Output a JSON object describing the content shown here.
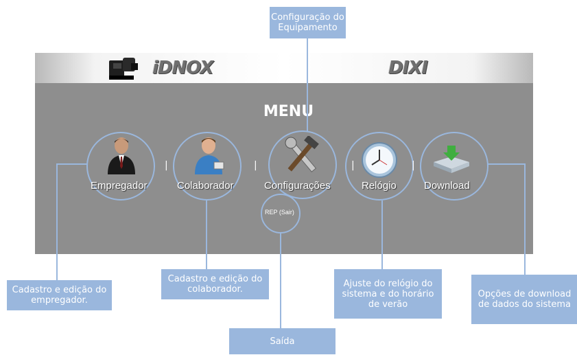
{
  "brand": {
    "left_logo": "iDNOX",
    "right_logo": "DIXI"
  },
  "menu": {
    "title": "MENU",
    "items": [
      {
        "label": "Empregador",
        "icon": "employer-icon"
      },
      {
        "label": "Colaborador",
        "icon": "collaborator-icon"
      },
      {
        "label": "Configurações",
        "icon": "tools-icon"
      },
      {
        "label": "Relógio",
        "icon": "clock-icon"
      },
      {
        "label": "Download",
        "icon": "download-icon"
      }
    ],
    "separator": "|",
    "exit_label": "REP (Sair)"
  },
  "callouts": {
    "config": "Configuração do Equipamento",
    "employer": "Cadastro e edição do empregador.",
    "collaborator": "Cadastro e edição do colaborador.",
    "clock": "Ajuste do relógio do sistema e do horário de verão",
    "download": "Opções de download de dados do sistema",
    "exit": "Saída"
  },
  "colors": {
    "panel": "#8e8e8e",
    "callout": "#9ab7dd",
    "text": "#ffffff"
  }
}
